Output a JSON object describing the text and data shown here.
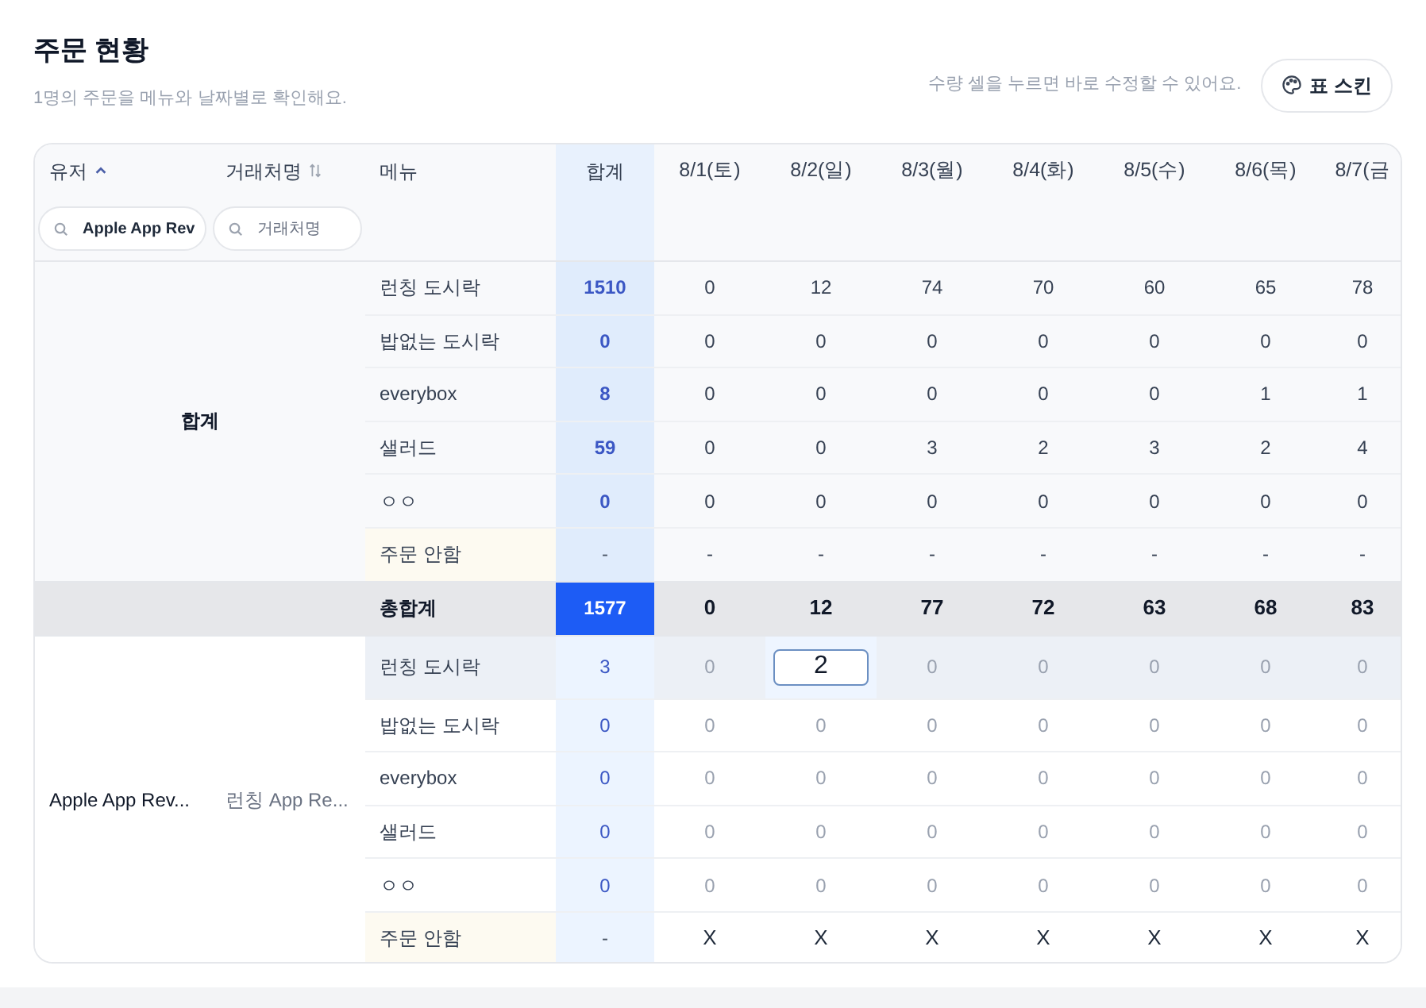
{
  "title": "주문 현황",
  "subtitle": "1명의 주문을 메뉴와 날짜별로 확인해요.",
  "hint": "수량 셀을 누르면 바로 수정할 수 있어요.",
  "skin_button": {
    "label": "표 스킨"
  },
  "columns": {
    "user": {
      "label": "유저",
      "sorted": true
    },
    "vendor": {
      "label": "거래처명",
      "sorted": false
    },
    "menu": {
      "label": "메뉴"
    },
    "total": {
      "label": "합계"
    },
    "dates": [
      "8/1(토)",
      "8/2(일)",
      "8/3(월)",
      "8/4(화)",
      "8/5(수)",
      "8/6(목)",
      "8/7(금"
    ]
  },
  "filters": [
    {
      "value": "Apple App Rev"
    },
    {
      "placeholder": "거래처명"
    }
  ],
  "sections": [
    {
      "kind": "group",
      "user": "합계",
      "rows": [
        {
          "menu": "런칭 도시락",
          "kind": "menu",
          "total": "1510",
          "values": [
            "0",
            "12",
            "74",
            "70",
            "60",
            "65",
            "78"
          ]
        },
        {
          "menu": "밥없는 도시락",
          "kind": "menu",
          "total": "0",
          "values": [
            "0",
            "0",
            "0",
            "0",
            "0",
            "0",
            "0"
          ]
        },
        {
          "menu": "everybox",
          "kind": "menu",
          "total": "8",
          "values": [
            "0",
            "0",
            "0",
            "0",
            "0",
            "1",
            "1"
          ]
        },
        {
          "menu": "샐러드",
          "kind": "menu",
          "total": "59",
          "values": [
            "0",
            "0",
            "3",
            "2",
            "3",
            "2",
            "4"
          ]
        },
        {
          "menu": "ㅇㅇ",
          "kind": "menu",
          "total": "0",
          "values": [
            "0",
            "0",
            "0",
            "0",
            "0",
            "0",
            "0"
          ]
        },
        {
          "menu": "주문 안함",
          "kind": "no_order",
          "total": "-",
          "values": [
            "-",
            "-",
            "-",
            "-",
            "-",
            "-",
            "-"
          ]
        }
      ]
    },
    {
      "kind": "grand_total",
      "label": "총합계",
      "total": "1577",
      "values": [
        "0",
        "12",
        "77",
        "72",
        "63",
        "68",
        "83"
      ]
    },
    {
      "kind": "user",
      "user": "Apple App Rev...",
      "vendor": "런칭 App Re...",
      "rows": [
        {
          "menu": "런칭 도시락",
          "kind": "menu",
          "hovered": true,
          "total": "3",
          "cells": [
            {
              "value": "0",
              "editing": false
            },
            {
              "value": "2",
              "editing": true
            },
            {
              "value": "0",
              "editing": false
            },
            {
              "value": "0",
              "editing": false
            },
            {
              "value": "0",
              "editing": false
            },
            {
              "value": "0",
              "editing": false
            },
            {
              "value": "0",
              "editing": false
            }
          ]
        },
        {
          "menu": "밥없는 도시락",
          "kind": "menu",
          "hovered": false,
          "total": "0",
          "cells": [
            {
              "value": "0",
              "editing": false
            },
            {
              "value": "0",
              "editing": false
            },
            {
              "value": "0",
              "editing": false
            },
            {
              "value": "0",
              "editing": false
            },
            {
              "value": "0",
              "editing": false
            },
            {
              "value": "0",
              "editing": false
            },
            {
              "value": "0",
              "editing": false
            }
          ]
        },
        {
          "menu": "everybox",
          "kind": "menu",
          "hovered": false,
          "total": "0",
          "cells": [
            {
              "value": "0",
              "editing": false
            },
            {
              "value": "0",
              "editing": false
            },
            {
              "value": "0",
              "editing": false
            },
            {
              "value": "0",
              "editing": false
            },
            {
              "value": "0",
              "editing": false
            },
            {
              "value": "0",
              "editing": false
            },
            {
              "value": "0",
              "editing": false
            }
          ]
        },
        {
          "menu": "샐러드",
          "kind": "menu",
          "hovered": false,
          "total": "0",
          "cells": [
            {
              "value": "0",
              "editing": false
            },
            {
              "value": "0",
              "editing": false
            },
            {
              "value": "0",
              "editing": false
            },
            {
              "value": "0",
              "editing": false
            },
            {
              "value": "0",
              "editing": false
            },
            {
              "value": "0",
              "editing": false
            },
            {
              "value": "0",
              "editing": false
            }
          ]
        },
        {
          "menu": "ㅇㅇ",
          "kind": "menu",
          "hovered": false,
          "total": "0",
          "cells": [
            {
              "value": "0",
              "editing": false
            },
            {
              "value": "0",
              "editing": false
            },
            {
              "value": "0",
              "editing": false
            },
            {
              "value": "0",
              "editing": false
            },
            {
              "value": "0",
              "editing": false
            },
            {
              "value": "0",
              "editing": false
            },
            {
              "value": "0",
              "editing": false
            }
          ]
        },
        {
          "menu": "주문 안함",
          "kind": "no_order",
          "hovered": false,
          "total": "-",
          "cells": [
            {
              "value": "X",
              "editing": false
            },
            {
              "value": "X",
              "editing": false
            },
            {
              "value": "X",
              "editing": false
            },
            {
              "value": "X",
              "editing": false
            },
            {
              "value": "X",
              "editing": false
            },
            {
              "value": "X",
              "editing": false
            },
            {
              "value": "X",
              "editing": false
            }
          ]
        }
      ]
    }
  ]
}
